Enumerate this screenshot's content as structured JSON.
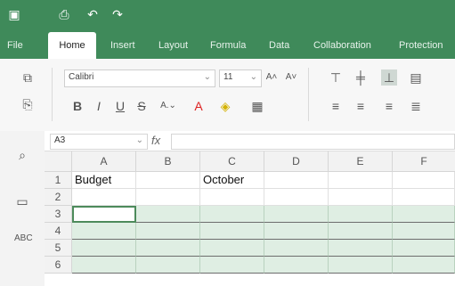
{
  "menus": [
    "File",
    "Home",
    "Insert",
    "Layout",
    "Formula",
    "Data",
    "Collaboration",
    "Protection"
  ],
  "font": {
    "name": "Calibri",
    "size": "11"
  },
  "name_box": "A3",
  "fx": "fx",
  "columns": [
    "A",
    "B",
    "C",
    "D",
    "E",
    "F"
  ],
  "rows": [
    "1",
    "2",
    "3",
    "4",
    "5",
    "6"
  ],
  "cells": {
    "A1": "Budget",
    "C1": "October"
  },
  "colors": {
    "accent": "#3f8a5a",
    "selection_fill": "#dfeee3"
  }
}
